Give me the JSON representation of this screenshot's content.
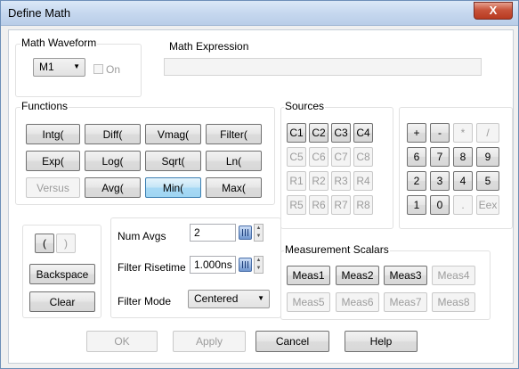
{
  "window": {
    "title": "Define Math",
    "close_glyph": "X"
  },
  "math_waveform": {
    "label": "Math Waveform",
    "selected": "M1",
    "on_label": "On"
  },
  "expression": {
    "label": "Math Expression",
    "value": ""
  },
  "functions": {
    "label": "Functions",
    "buttons": [
      "Intg(",
      "Diff(",
      "Vmag(",
      "Filter(",
      "Exp(",
      "Log(",
      "Sqrt(",
      "Ln(",
      "Versus",
      "Avg(",
      "Min(",
      "Max("
    ]
  },
  "sources": {
    "label": "Sources",
    "buttons": [
      "C1",
      "C2",
      "C3",
      "C4",
      "C5",
      "C6",
      "C7",
      "C8",
      "R1",
      "R2",
      "R3",
      "R4",
      "R5",
      "R6",
      "R7",
      "R8"
    ]
  },
  "keypad": {
    "buttons": [
      "+",
      "-",
      "*",
      "/",
      "6",
      "7",
      "8",
      "9",
      "2",
      "3",
      "4",
      "5",
      "1",
      "0",
      ".",
      "Eex"
    ]
  },
  "parens": {
    "open": "(",
    "close": ")",
    "backspace": "Backspace",
    "clear": "Clear"
  },
  "params": {
    "num_avgs_label": "Num Avgs",
    "num_avgs_value": "2",
    "filter_risetime_label": "Filter Risetime",
    "filter_risetime_value": "1.000ns",
    "filter_mode_label": "Filter Mode",
    "filter_mode_value": "Centered"
  },
  "scalars": {
    "label": "Measurement Scalars",
    "buttons": [
      "Meas1",
      "Meas2",
      "Meas3",
      "Meas4",
      "Meas5",
      "Meas6",
      "Meas7",
      "Meas8"
    ]
  },
  "footer": {
    "ok": "OK",
    "apply": "Apply",
    "cancel": "Cancel",
    "help": "Help"
  }
}
